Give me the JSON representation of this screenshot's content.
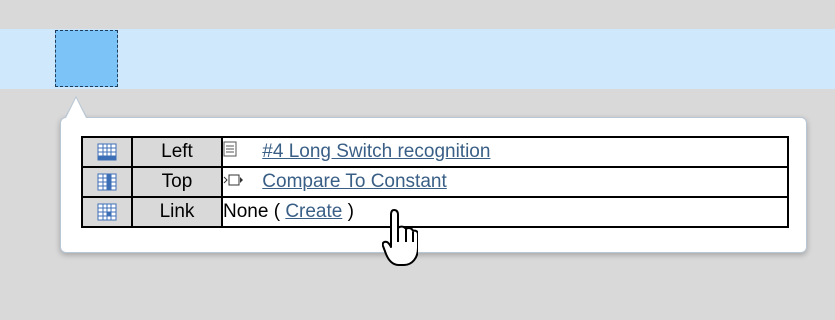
{
  "rows": [
    {
      "label": "Left",
      "value": "#4 Long Switch recognition",
      "icon": "document-icon",
      "link": true
    },
    {
      "label": "Top",
      "value": "Compare To Constant",
      "icon": "block-icon",
      "link": true
    },
    {
      "label": "Link",
      "prefix": "None ( ",
      "value": "Create",
      "suffix": " )",
      "icon": "none",
      "link": true
    }
  ],
  "colors": {
    "row_band": "#cfe8fb",
    "selected_cell": "#7cc3f7",
    "link": "#3a5f86",
    "header_bg": "#d9d9d9"
  }
}
